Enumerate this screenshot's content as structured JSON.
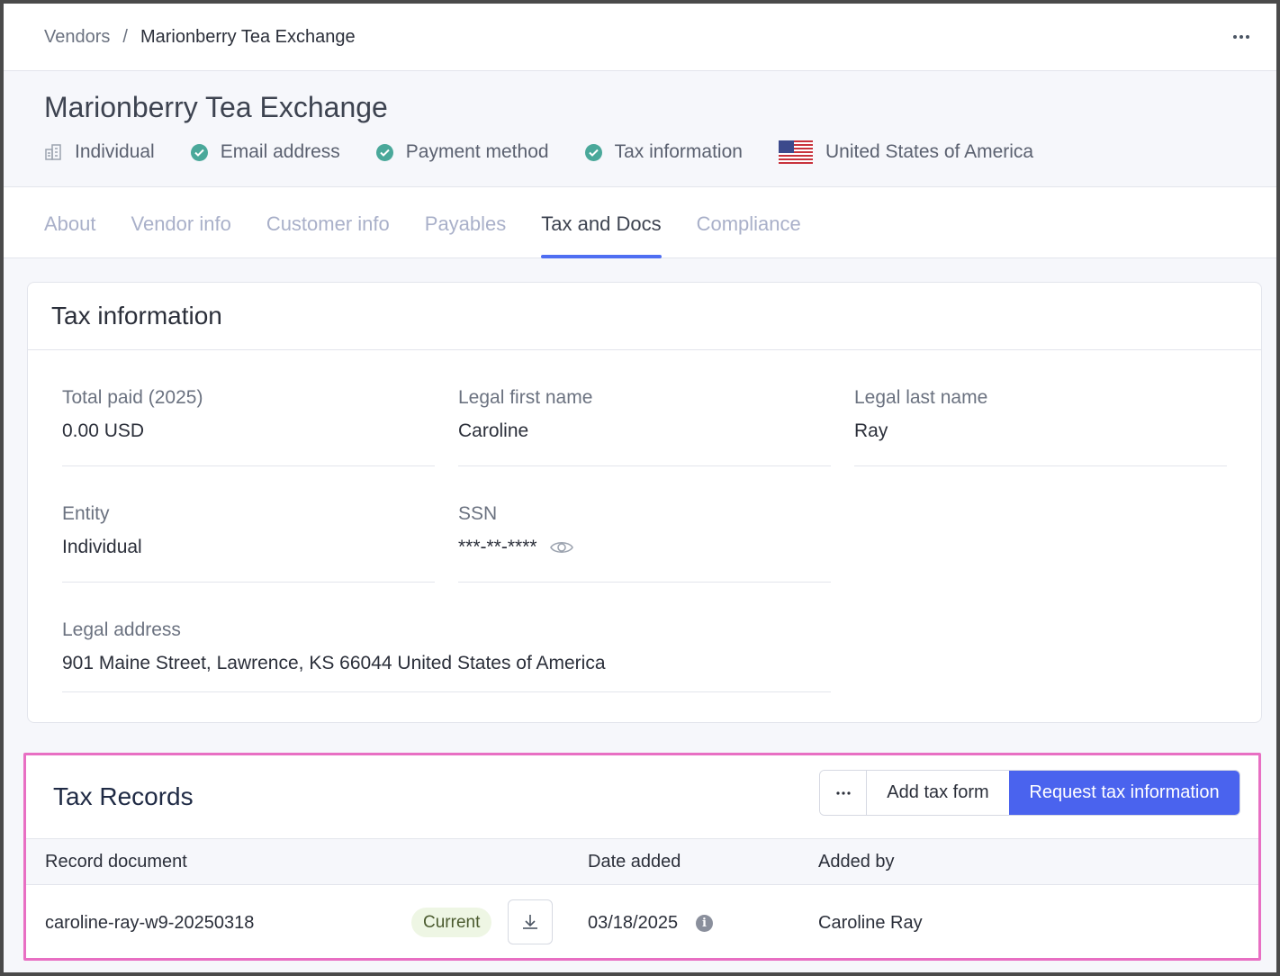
{
  "breadcrumb": {
    "parent": "Vendors",
    "separator": "/",
    "current": "Marionberry Tea Exchange"
  },
  "header": {
    "title": "Marionberry Tea Exchange",
    "meta": [
      {
        "icon": "building-icon",
        "label": "Individual"
      },
      {
        "icon": "check-circle-icon",
        "label": "Email address"
      },
      {
        "icon": "check-circle-icon",
        "label": "Payment method"
      },
      {
        "icon": "check-circle-icon",
        "label": "Tax information"
      },
      {
        "icon": "us-flag-icon",
        "label": "United States of America"
      }
    ]
  },
  "tabs": [
    {
      "label": "About",
      "active": false
    },
    {
      "label": "Vendor info",
      "active": false
    },
    {
      "label": "Customer info",
      "active": false
    },
    {
      "label": "Payables",
      "active": false
    },
    {
      "label": "Tax and Docs",
      "active": true
    },
    {
      "label": "Compliance",
      "active": false
    }
  ],
  "tax_info": {
    "title": "Tax information",
    "total_paid": {
      "label": "Total paid (2025)",
      "value": "0.00 USD"
    },
    "first_name": {
      "label": "Legal first name",
      "value": "Caroline"
    },
    "last_name": {
      "label": "Legal last name",
      "value": "Ray"
    },
    "entity": {
      "label": "Entity",
      "value": "Individual"
    },
    "ssn": {
      "label": "SSN",
      "value": "***-**-****"
    },
    "address": {
      "label": "Legal address",
      "value": "901 Maine Street, Lawrence, KS 66044 United States of America"
    }
  },
  "tax_records": {
    "title": "Tax Records",
    "more_label": "···",
    "add_label": "Add tax form",
    "request_label": "Request tax information",
    "columns": [
      "Record document",
      "Date added",
      "Added by"
    ],
    "rows": [
      {
        "document": "caroline-ray-w9-20250318",
        "status": "Current",
        "date": "03/18/2025",
        "added_by": "Caroline Ray"
      }
    ]
  },
  "colors": {
    "accent": "#4a63ee",
    "tab_active_underline": "#4f6ef2",
    "check": "#4aa89a",
    "highlight_border": "#e86fc3"
  }
}
